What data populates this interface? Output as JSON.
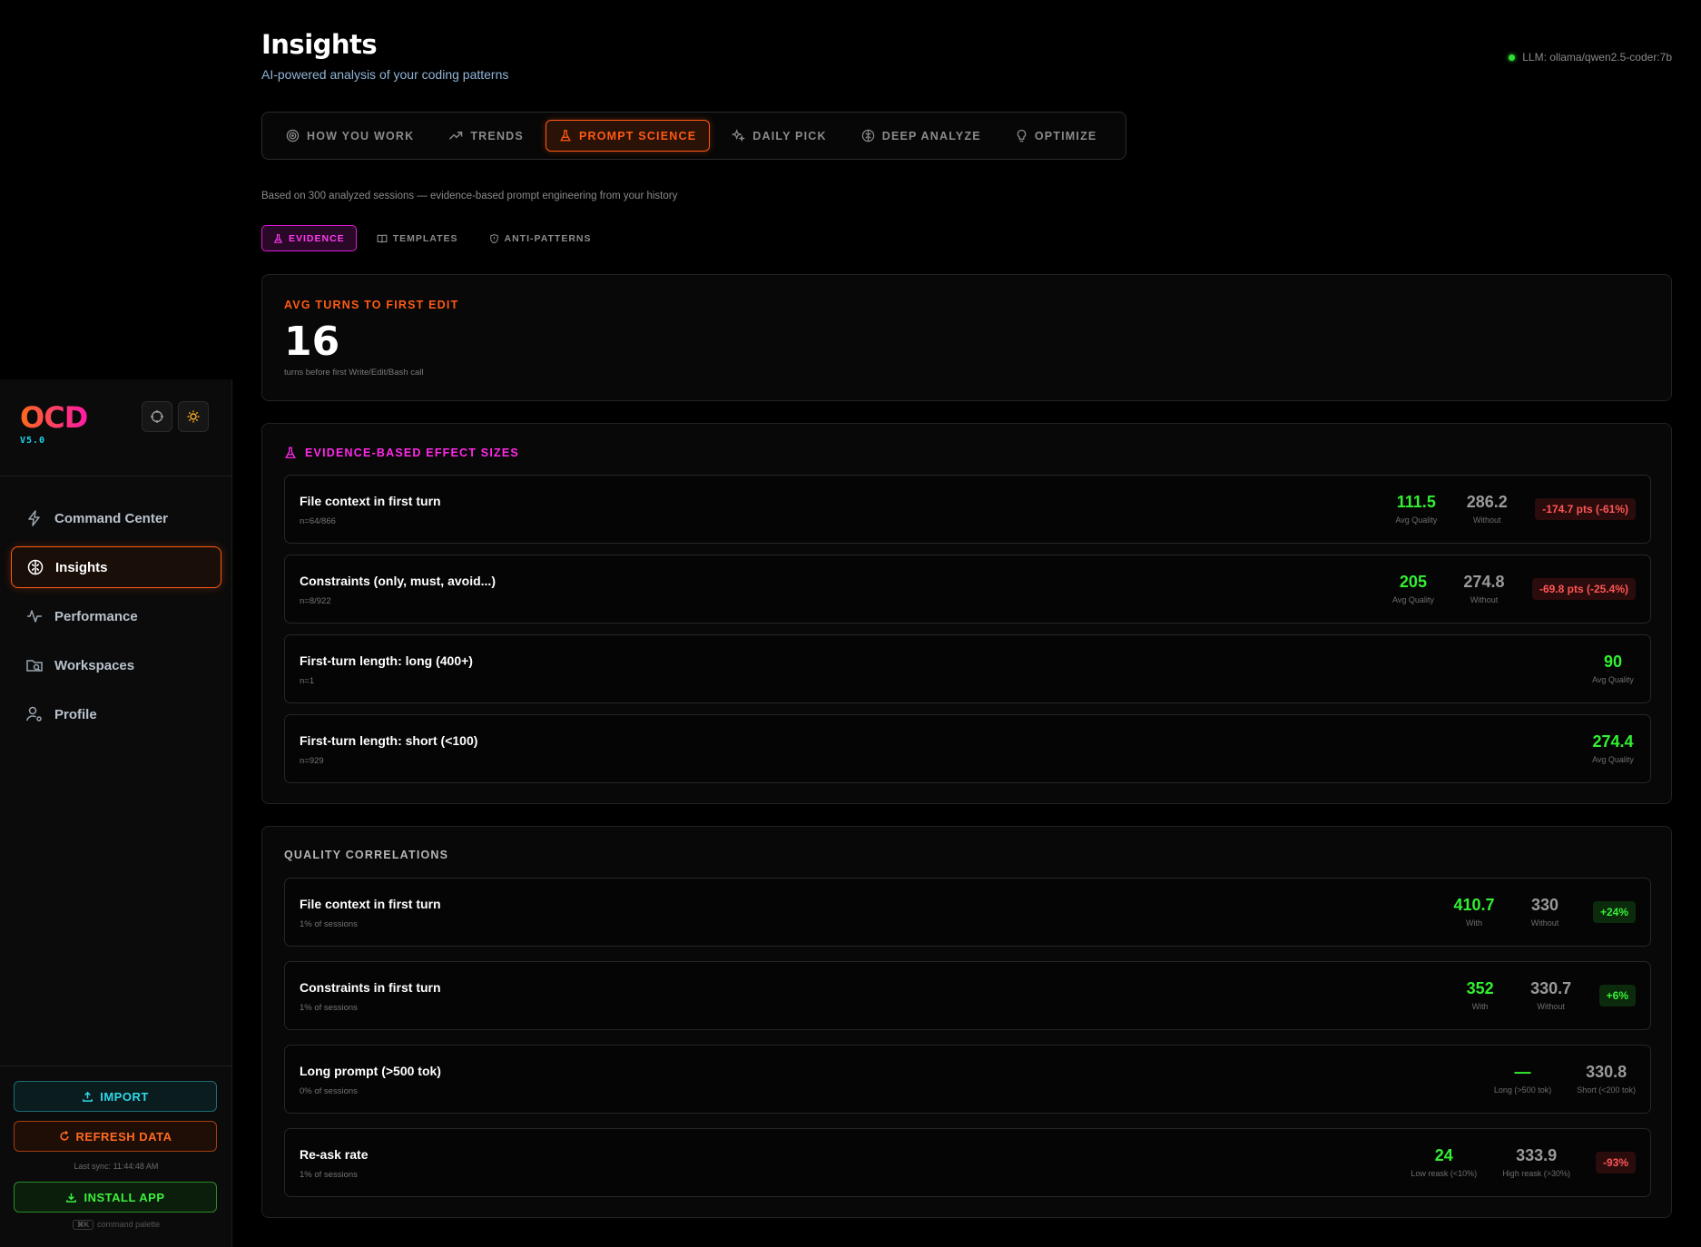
{
  "app": {
    "logo": "OCD",
    "version": "V5.0"
  },
  "sidebar": {
    "nav": [
      {
        "label": "Command Center",
        "icon": "lightning-icon"
      },
      {
        "label": "Insights",
        "icon": "brain-icon",
        "active": true
      },
      {
        "label": "Performance",
        "icon": "activity-icon"
      },
      {
        "label": "Workspaces",
        "icon": "folder-search-icon"
      },
      {
        "label": "Profile",
        "icon": "user-gear-icon"
      }
    ],
    "import_label": "IMPORT",
    "refresh_label": "REFRESH DATA",
    "last_sync": "Last sync: 11:44:48 AM",
    "install_label": "INSTALL APP",
    "shortcut_key": "⌘K",
    "shortcut_hint": "command palette"
  },
  "header": {
    "title": "Insights",
    "subtitle": "AI-powered analysis of your coding patterns",
    "llm_status": "LLM: ollama/qwen2.5-coder:7b"
  },
  "tabs": [
    {
      "label": "HOW YOU WORK",
      "icon": "target-icon"
    },
    {
      "label": "TRENDS",
      "icon": "trending-up-icon"
    },
    {
      "label": "PROMPT SCIENCE",
      "icon": "flask-icon",
      "active": true
    },
    {
      "label": "DAILY PICK",
      "icon": "sparkles-icon"
    },
    {
      "label": "DEEP ANALYZE",
      "icon": "brain-icon"
    },
    {
      "label": "OPTIMIZE",
      "icon": "lightbulb-icon"
    }
  ],
  "based_on": "Based on 300 analyzed sessions — evidence-based prompt engineering from your history",
  "subtabs": [
    {
      "label": "EVIDENCE",
      "icon": "flask-icon",
      "active": true
    },
    {
      "label": "TEMPLATES",
      "icon": "book-icon"
    },
    {
      "label": "ANTI-PATTERNS",
      "icon": "shield-icon"
    }
  ],
  "avg_turns": {
    "label": "AVG TURNS TO FIRST EDIT",
    "value": "16",
    "note": "turns before first Write/Edit/Bash call"
  },
  "effect_sizes": {
    "title": "EVIDENCE-BASED EFFECT SIZES",
    "rows": [
      {
        "name": "File context in first turn",
        "sub": "n=64/866",
        "with": "111.5",
        "with_label": "Avg Quality",
        "without": "286.2",
        "without_label": "Without",
        "badge": "-174.7 pts (-61%)"
      },
      {
        "name": "Constraints (only, must, avoid...)",
        "sub": "n=8/922",
        "with": "205",
        "with_label": "Avg Quality",
        "without": "274.8",
        "without_label": "Without",
        "badge": "-69.8 pts (-25.4%)"
      },
      {
        "name": "First-turn length: long (400+)",
        "sub": "n=1",
        "with": "90",
        "with_label": "Avg Quality"
      },
      {
        "name": "First-turn length: short (<100)",
        "sub": "n=929",
        "with": "274.4",
        "with_label": "Avg Quality"
      }
    ]
  },
  "correlations": {
    "title": "QUALITY CORRELATIONS",
    "rows": [
      {
        "name": "File context in first turn",
        "sub": "1% of sessions",
        "with": "410.7",
        "with_label": "With",
        "without": "330",
        "without_label": "Without",
        "badge": "+24%"
      },
      {
        "name": "Constraints in first turn",
        "sub": "1% of sessions",
        "with": "352",
        "with_label": "With",
        "without": "330.7",
        "without_label": "Without",
        "badge": "+6%"
      },
      {
        "name": "Long prompt (>500 tok)",
        "sub": "0% of sessions",
        "with": "—",
        "with_label": "Long (>500 tok)",
        "without": "330.8",
        "without_label": "Short (<200 tok)"
      },
      {
        "name": "Re-ask rate",
        "sub": "1% of sessions",
        "with": "24",
        "with_label": "Low reask (<10%)",
        "without": "333.9",
        "without_label": "High reask (>30%)",
        "badge": "-93%"
      }
    ]
  },
  "colors": {
    "accent_orange": "#ff5a14",
    "accent_magenta": "#ff2ae8",
    "positive": "#32f032",
    "negative": "#ff5555",
    "cyan": "#2fd8e8"
  }
}
